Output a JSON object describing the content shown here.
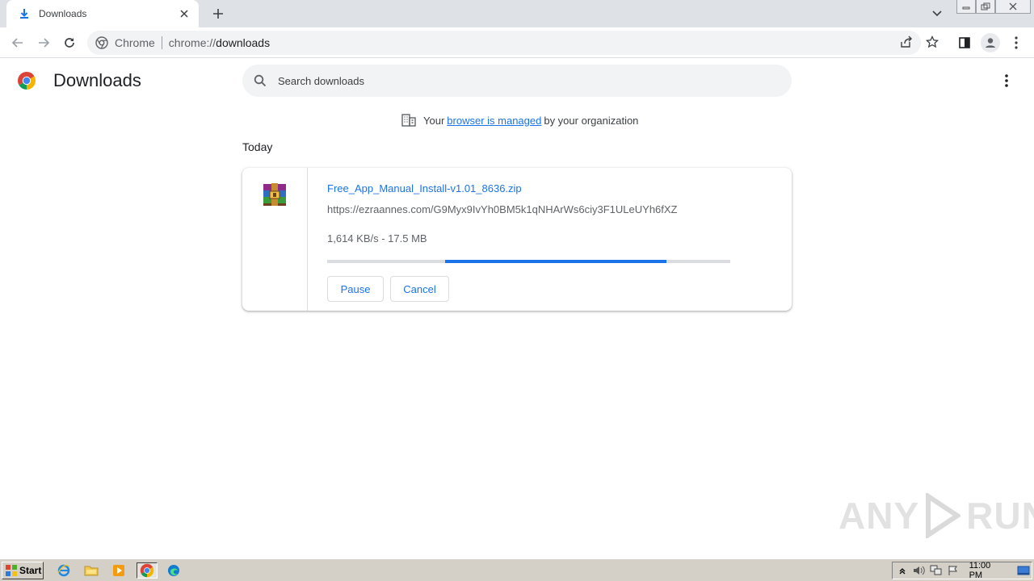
{
  "browser": {
    "tab": {
      "title": "Downloads"
    },
    "omnibox": {
      "chip": "Chrome",
      "url_scheme": "chrome://",
      "url_host": "downloads"
    }
  },
  "page": {
    "title": "Downloads",
    "search": {
      "placeholder": "Search downloads"
    },
    "managed": {
      "prefix": "Your",
      "link": "browser is managed",
      "suffix": "by your organization"
    },
    "section_date": "Today"
  },
  "download": {
    "file_name": "Free_App_Manual_Install-v1.01_8636.zip",
    "url": "https://ezraannes.com/G9Myx9IvYh0BM5k1qNHArWs6ciy3F1ULeUYh6fXZ",
    "status": "1,614 KB/s - 17.5 MB",
    "progress_fraction": 0.55,
    "pause_label": "Pause",
    "cancel_label": "Cancel"
  },
  "watermark": {
    "left": "ANY",
    "right": "RUN"
  },
  "taskbar": {
    "start_label": "Start",
    "clock": "11:00 PM"
  },
  "colors": {
    "accent": "#1a73e8",
    "tabstrip": "#dee1e6",
    "taskbar": "#d4d0c8"
  }
}
